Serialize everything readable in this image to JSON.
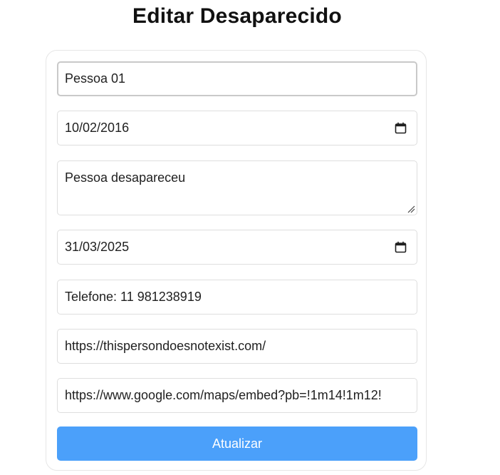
{
  "page": {
    "title": "Editar Desaparecido"
  },
  "form": {
    "name": "Pessoa 01",
    "birth_date": "10/02/2016",
    "description": "Pessoa desapareceu",
    "disappearance_date": "31/03/2025",
    "contact": "Telefone: 11 981238919",
    "photo_url": "https://thispersondoesnotexist.com/",
    "map_url": "https://www.google.com/maps/embed?pb=!1m14!1m12!",
    "submit_label": "Atualizar"
  },
  "icons": {
    "date_picker": "calendar-icon",
    "textarea_resize": "resize-grip-icon"
  },
  "colors": {
    "button": "#4ba0fa",
    "button_text": "#ffffff"
  }
}
